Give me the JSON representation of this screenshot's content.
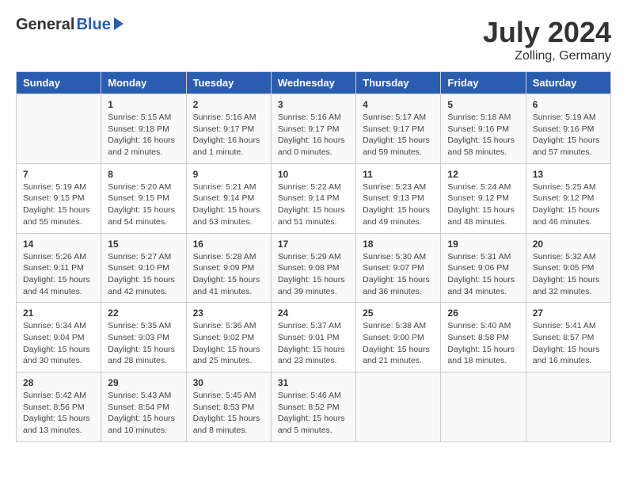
{
  "header": {
    "logo_general": "General",
    "logo_blue": "Blue",
    "month_title": "July 2024",
    "location": "Zolling, Germany"
  },
  "columns": [
    "Sunday",
    "Monday",
    "Tuesday",
    "Wednesday",
    "Thursday",
    "Friday",
    "Saturday"
  ],
  "weeks": [
    {
      "days": [
        {
          "num": "",
          "info": ""
        },
        {
          "num": "1",
          "info": "Sunrise: 5:15 AM\nSunset: 9:18 PM\nDaylight: 16 hours\nand 2 minutes."
        },
        {
          "num": "2",
          "info": "Sunrise: 5:16 AM\nSunset: 9:17 PM\nDaylight: 16 hours\nand 1 minute."
        },
        {
          "num": "3",
          "info": "Sunrise: 5:16 AM\nSunset: 9:17 PM\nDaylight: 16 hours\nand 0 minutes."
        },
        {
          "num": "4",
          "info": "Sunrise: 5:17 AM\nSunset: 9:17 PM\nDaylight: 15 hours\nand 59 minutes."
        },
        {
          "num": "5",
          "info": "Sunrise: 5:18 AM\nSunset: 9:16 PM\nDaylight: 15 hours\nand 58 minutes."
        },
        {
          "num": "6",
          "info": "Sunrise: 5:19 AM\nSunset: 9:16 PM\nDaylight: 15 hours\nand 57 minutes."
        }
      ]
    },
    {
      "days": [
        {
          "num": "7",
          "info": "Sunrise: 5:19 AM\nSunset: 9:15 PM\nDaylight: 15 hours\nand 55 minutes."
        },
        {
          "num": "8",
          "info": "Sunrise: 5:20 AM\nSunset: 9:15 PM\nDaylight: 15 hours\nand 54 minutes."
        },
        {
          "num": "9",
          "info": "Sunrise: 5:21 AM\nSunset: 9:14 PM\nDaylight: 15 hours\nand 53 minutes."
        },
        {
          "num": "10",
          "info": "Sunrise: 5:22 AM\nSunset: 9:14 PM\nDaylight: 15 hours\nand 51 minutes."
        },
        {
          "num": "11",
          "info": "Sunrise: 5:23 AM\nSunset: 9:13 PM\nDaylight: 15 hours\nand 49 minutes."
        },
        {
          "num": "12",
          "info": "Sunrise: 5:24 AM\nSunset: 9:12 PM\nDaylight: 15 hours\nand 48 minutes."
        },
        {
          "num": "13",
          "info": "Sunrise: 5:25 AM\nSunset: 9:12 PM\nDaylight: 15 hours\nand 46 minutes."
        }
      ]
    },
    {
      "days": [
        {
          "num": "14",
          "info": "Sunrise: 5:26 AM\nSunset: 9:11 PM\nDaylight: 15 hours\nand 44 minutes."
        },
        {
          "num": "15",
          "info": "Sunrise: 5:27 AM\nSunset: 9:10 PM\nDaylight: 15 hours\nand 42 minutes."
        },
        {
          "num": "16",
          "info": "Sunrise: 5:28 AM\nSunset: 9:09 PM\nDaylight: 15 hours\nand 41 minutes."
        },
        {
          "num": "17",
          "info": "Sunrise: 5:29 AM\nSunset: 9:08 PM\nDaylight: 15 hours\nand 39 minutes."
        },
        {
          "num": "18",
          "info": "Sunrise: 5:30 AM\nSunset: 9:07 PM\nDaylight: 15 hours\nand 36 minutes."
        },
        {
          "num": "19",
          "info": "Sunrise: 5:31 AM\nSunset: 9:06 PM\nDaylight: 15 hours\nand 34 minutes."
        },
        {
          "num": "20",
          "info": "Sunrise: 5:32 AM\nSunset: 9:05 PM\nDaylight: 15 hours\nand 32 minutes."
        }
      ]
    },
    {
      "days": [
        {
          "num": "21",
          "info": "Sunrise: 5:34 AM\nSunset: 9:04 PM\nDaylight: 15 hours\nand 30 minutes."
        },
        {
          "num": "22",
          "info": "Sunrise: 5:35 AM\nSunset: 9:03 PM\nDaylight: 15 hours\nand 28 minutes."
        },
        {
          "num": "23",
          "info": "Sunrise: 5:36 AM\nSunset: 9:02 PM\nDaylight: 15 hours\nand 25 minutes."
        },
        {
          "num": "24",
          "info": "Sunrise: 5:37 AM\nSunset: 9:01 PM\nDaylight: 15 hours\nand 23 minutes."
        },
        {
          "num": "25",
          "info": "Sunrise: 5:38 AM\nSunset: 9:00 PM\nDaylight: 15 hours\nand 21 minutes."
        },
        {
          "num": "26",
          "info": "Sunrise: 5:40 AM\nSunset: 8:58 PM\nDaylight: 15 hours\nand 18 minutes."
        },
        {
          "num": "27",
          "info": "Sunrise: 5:41 AM\nSunset: 8:57 PM\nDaylight: 15 hours\nand 16 minutes."
        }
      ]
    },
    {
      "days": [
        {
          "num": "28",
          "info": "Sunrise: 5:42 AM\nSunset: 8:56 PM\nDaylight: 15 hours\nand 13 minutes."
        },
        {
          "num": "29",
          "info": "Sunrise: 5:43 AM\nSunset: 8:54 PM\nDaylight: 15 hours\nand 10 minutes."
        },
        {
          "num": "30",
          "info": "Sunrise: 5:45 AM\nSunset: 8:53 PM\nDaylight: 15 hours\nand 8 minutes."
        },
        {
          "num": "31",
          "info": "Sunrise: 5:46 AM\nSunset: 8:52 PM\nDaylight: 15 hours\nand 5 minutes."
        },
        {
          "num": "",
          "info": ""
        },
        {
          "num": "",
          "info": ""
        },
        {
          "num": "",
          "info": ""
        }
      ]
    }
  ]
}
